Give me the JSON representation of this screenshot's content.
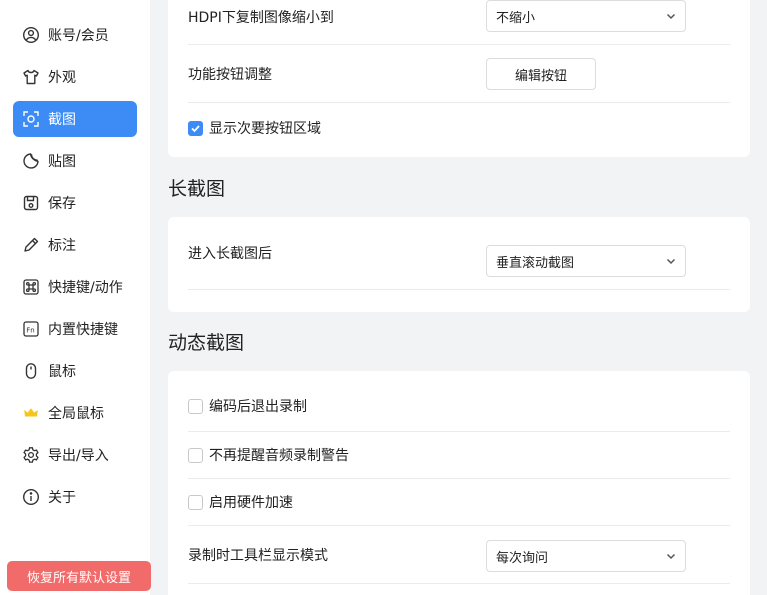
{
  "sidebar": {
    "items": [
      {
        "label": "账号/会员",
        "icon": "user-circle-icon"
      },
      {
        "label": "外观",
        "icon": "tshirt-icon"
      },
      {
        "label": "截图",
        "icon": "screenshot-icon",
        "active": true
      },
      {
        "label": "贴图",
        "icon": "sticker-icon"
      },
      {
        "label": "保存",
        "icon": "save-icon"
      },
      {
        "label": "标注",
        "icon": "pencil-icon"
      },
      {
        "label": "快捷键/动作",
        "icon": "command-icon"
      },
      {
        "label": "内置快捷键",
        "icon": "fn-key-icon"
      },
      {
        "label": "鼠标",
        "icon": "mouse-icon"
      },
      {
        "label": "全局鼠标",
        "icon": "crown-icon"
      },
      {
        "label": "导出/导入",
        "icon": "gear-icon"
      },
      {
        "label": "关于",
        "icon": "info-icon"
      }
    ],
    "reset_label": "恢复所有默认设置"
  },
  "screenshot_section": {
    "hdpi_label": "HDPI下复制图像缩小到",
    "hdpi_value": "不缩小",
    "func_buttons_label": "功能按钮调整",
    "edit_buttons_label": "编辑按钮",
    "show_secondary_label": "显示次要按钮区域",
    "show_secondary_checked": true
  },
  "long_screenshot": {
    "title": "长截图",
    "after_enter_label": "进入长截图后",
    "after_enter_value": "垂直滚动截图"
  },
  "dynamic_screenshot": {
    "title": "动态截图",
    "exit_after_encode_label": "编码后退出录制",
    "no_audio_warning_label": "不再提醒音频录制警告",
    "hw_accel_label": "启用硬件加速",
    "toolbar_mode_label": "录制时工具栏显示模式",
    "toolbar_mode_value": "每次询问"
  },
  "colors": {
    "accent": "#3d8cf5",
    "danger": "#f26b6b",
    "background": "#f2f3f5"
  }
}
